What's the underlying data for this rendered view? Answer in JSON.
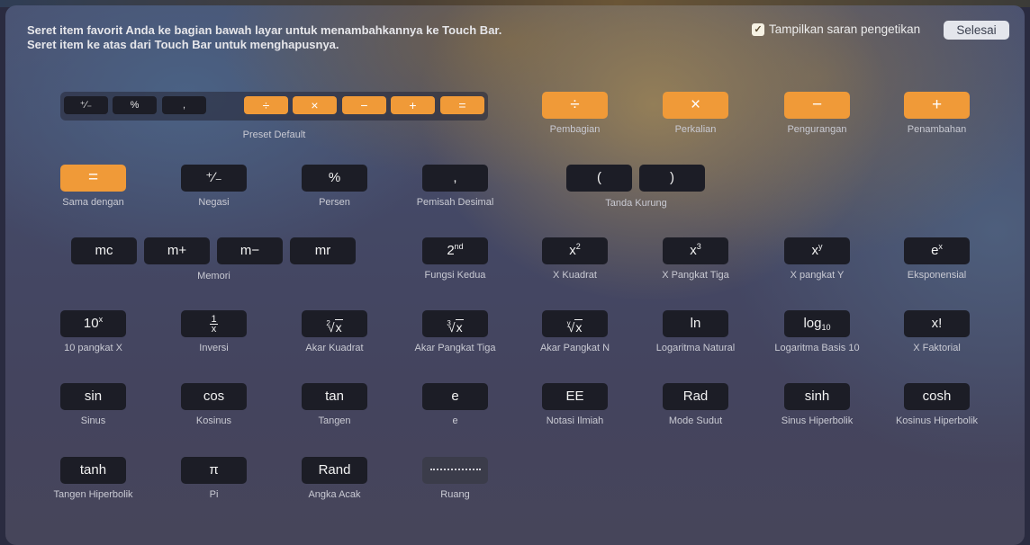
{
  "header": {
    "instruction_line1": "Seret item favorit Anda ke bagian bawah layar untuk menambahkannya ke Touch Bar.",
    "instruction_line2": "Seret item ke atas dari Touch Bar untuk menghapusnya.",
    "suggestions_checkbox": {
      "label": "Tampilkan saran pengetikan",
      "checked": true,
      "icon": "checkmark-icon"
    },
    "done_button": "Selesai"
  },
  "colors": {
    "orange_key": "#f09a38",
    "dark_key": "#1c1d26",
    "label_text": "#c9cad3"
  },
  "preset": {
    "label": "Preset Default",
    "keys": [
      "⁺∕₋",
      "%",
      ",",
      "÷",
      "×",
      "−",
      "+",
      "="
    ]
  },
  "rows": [
    {
      "items": [
        {
          "key": "÷",
          "label": "Pembagian"
        },
        {
          "key": "×",
          "label": "Perkalian"
        },
        {
          "key": "−",
          "label": "Pengurangan"
        },
        {
          "key": "+",
          "label": "Penambahan"
        }
      ]
    },
    {
      "items": [
        {
          "key": "=",
          "label": "Sama dengan"
        },
        {
          "key": "⁺∕₋",
          "label": "Negasi"
        },
        {
          "key": "%",
          "label": "Persen"
        },
        {
          "key": ",",
          "label": "Pemisah Desimal"
        }
      ],
      "group": {
        "label": "Tanda Kurung",
        "keys": [
          "(",
          ")"
        ]
      }
    },
    {
      "group": {
        "label": "Memori",
        "keys": [
          "mc",
          "m+",
          "m−",
          "mr"
        ]
      },
      "items": [
        {
          "key": "2",
          "sup": "nd",
          "label": "Fungsi Kedua"
        },
        {
          "key": "x",
          "sup": "2",
          "label": "X Kuadrat"
        },
        {
          "key": "x",
          "sup": "3",
          "label": "X Pangkat Tiga"
        },
        {
          "key": "x",
          "sup": "y",
          "label": "X pangkat Y"
        },
        {
          "key": "e",
          "sup": "x",
          "label": "Eksponensial"
        }
      ]
    },
    {
      "items": [
        {
          "key": "10",
          "sup": "x",
          "label": "10 pangkat X"
        },
        {
          "key_num": "1",
          "key_den": "x",
          "label": "Inversi"
        },
        {
          "root_index": "2",
          "root_body": "x",
          "label": "Akar Kuadrat"
        },
        {
          "root_index": "3",
          "root_body": "x",
          "label": "Akar Pangkat Tiga"
        },
        {
          "root_index": "y",
          "root_body": "x",
          "label": "Akar Pangkat N"
        },
        {
          "key": "ln",
          "label": "Logaritma Natural"
        },
        {
          "key": "log",
          "sub": "10",
          "label": "Logaritma Basis 10"
        },
        {
          "key": "x!",
          "label": "X Faktorial"
        }
      ]
    },
    {
      "items": [
        {
          "key": "sin",
          "label": "Sinus"
        },
        {
          "key": "cos",
          "label": "Kosinus"
        },
        {
          "key": "tan",
          "label": "Tangen"
        },
        {
          "key": "e",
          "label": "e"
        },
        {
          "key": "EE",
          "label": "Notasi Ilmiah"
        },
        {
          "key": "Rad",
          "label": "Mode Sudut"
        },
        {
          "key": "sinh",
          "label": "Sinus Hiperbolik"
        },
        {
          "key": "cosh",
          "label": "Kosinus Hiperbolik"
        }
      ]
    },
    {
      "items": [
        {
          "key": "tanh",
          "label": "Tangen Hiperbolik"
        },
        {
          "key": "π",
          "label": "Pi"
        },
        {
          "key": "Rand",
          "label": "Angka Acak"
        },
        {
          "key": "",
          "label": "Ruang",
          "icon": "space-dots-icon"
        }
      ]
    }
  ]
}
